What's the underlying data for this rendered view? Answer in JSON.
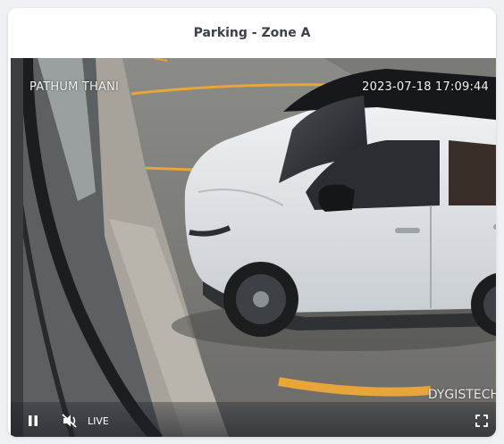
{
  "card": {
    "title": "Parking - Zone A"
  },
  "video": {
    "location_overlay": "PATHUM THANI",
    "timestamp_overlay": "2023-07-18 17:09:44",
    "watermark": "DYGISTECH",
    "state": "playing",
    "muted": true
  },
  "controls": {
    "pause_icon": "pause-icon",
    "mute_icon": "volume-muted-icon",
    "live_label": "LIVE",
    "fullscreen_icon": "fullscreen-icon"
  },
  "colors": {
    "card_background": "#ffffff",
    "page_background": "#eef0f3",
    "title_text": "#3a3f4b",
    "parking_line": "#e8a53a",
    "car_body": "#dfe3e7"
  }
}
